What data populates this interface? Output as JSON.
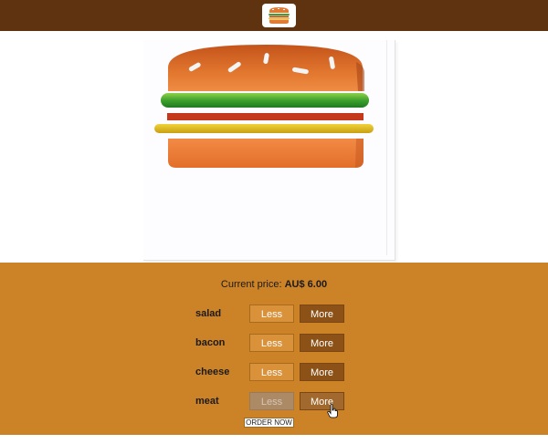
{
  "toolbar": {
    "logo_icon": "burger-logo-icon",
    "color": "#5f3210"
  },
  "burger": {
    "layers": [
      "bread-top",
      "salad",
      "bacon",
      "cheese",
      "bread-bottom"
    ],
    "colors": {
      "bread": "#e07a34",
      "salad": "#3ea12c",
      "bacon": "#c4381c",
      "cheese": "#e2bf1c"
    }
  },
  "controls": {
    "price_label": "Current price:",
    "price_value": "AU$ 6.00",
    "less_label": "Less",
    "more_label": "More",
    "ingredients": [
      {
        "label": "salad",
        "less_disabled": false
      },
      {
        "label": "bacon",
        "less_disabled": false
      },
      {
        "label": "cheese",
        "less_disabled": false
      },
      {
        "label": "meat",
        "less_disabled": true
      }
    ],
    "order_label": "ORDER NOW",
    "background": "#cc8328"
  }
}
